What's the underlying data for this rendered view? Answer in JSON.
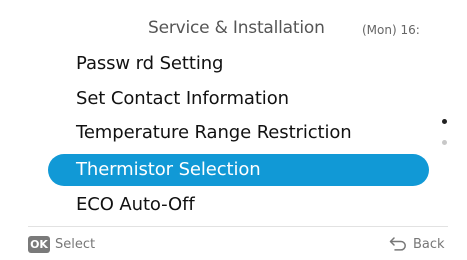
{
  "header": {
    "title": "Service & Installation",
    "clock": "(Mon) 16:"
  },
  "menu": {
    "items": [
      {
        "label": "Passw  rd Setting"
      },
      {
        "label": "Set Contact Information"
      },
      {
        "label": "Temperature Range Restriction"
      },
      {
        "label": "Thermistor Selection",
        "selected": true
      },
      {
        "label": "ECO Auto-Off"
      }
    ]
  },
  "scrollbar": {
    "page": 1,
    "pages": 2
  },
  "footer": {
    "ok_badge": "OK",
    "select_label": "Select",
    "back_icon": "back-arrow-icon",
    "back_label": "Back"
  },
  "colors": {
    "selection": "#1199d6",
    "text": "#111111",
    "muted": "#777777"
  }
}
